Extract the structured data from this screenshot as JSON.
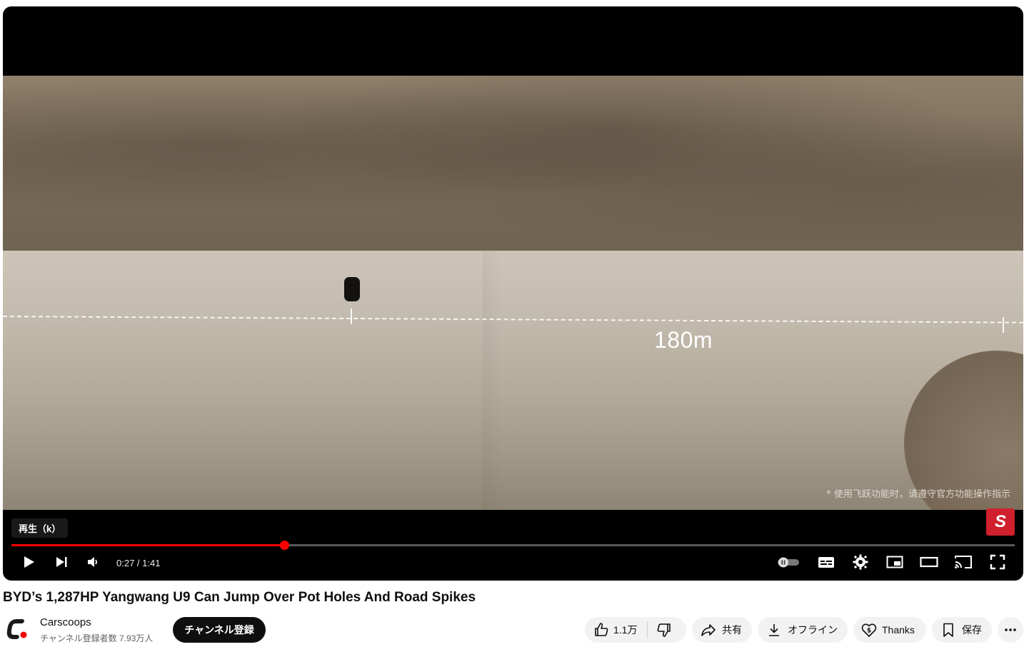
{
  "video": {
    "overlay_distance": "180m",
    "disclaimer": "* 使用飞跃功能时，请遵守官方功能操作指示",
    "corner_logo": "S"
  },
  "player": {
    "tooltip": "再生（k）",
    "current_time": "0:27",
    "duration": "1:41",
    "time_display": "0:27 / 1:41",
    "progress_fraction": 0.272,
    "accent_color": "#ff0000",
    "icons": [
      "play-icon",
      "next-icon",
      "volume-icon",
      "autoplay-toggle-icon",
      "subtitles-icon",
      "settings-icon",
      "miniplayer-icon",
      "theater-mode-icon",
      "cast-icon",
      "fullscreen-icon"
    ]
  },
  "title": "BYD’s 1,287HP Yangwang U9 Can Jump Over Pot Holes And Road Spikes",
  "channel": {
    "name": "Carscoops",
    "subscribers": "チャンネル登録者数 7.93万人",
    "subscribe_label": "チャンネル登録"
  },
  "actions": {
    "like_count": "1.1万",
    "share_label": "共有",
    "offline_label": "オフライン",
    "thanks_label": "Thanks",
    "save_label": "保存"
  }
}
